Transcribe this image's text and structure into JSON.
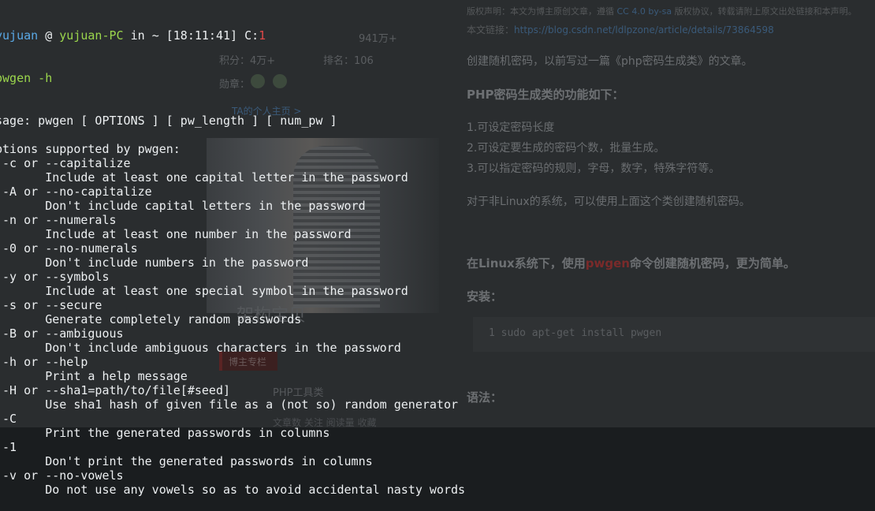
{
  "terminal": {
    "prompt": {
      "user": "yujuan",
      "at": " @ ",
      "host": "yujuan-PC",
      "in": " in ",
      "dir": "~",
      "time": " [18:11:41]",
      "status_label": " C:",
      "status_code": "1"
    },
    "command": "pwgen -h",
    "lines": [
      "sage: pwgen [ OPTIONS ] [ pw_length ] [ num_pw ]",
      "",
      "ptions supported by pwgen:",
      " -c or --capitalize",
      "       Include at least one capital letter in the password",
      " -A or --no-capitalize",
      "       Don't include capital letters in the password",
      " -n or --numerals",
      "       Include at least one number in the password",
      " -0 or --no-numerals",
      "       Don't include numbers in the password",
      " -y or --symbols",
      "       Include at least one special symbol in the password",
      " -s or --secure",
      "       Generate completely random passwords",
      " -B or --ambiguous",
      "       Don't include ambiguous characters in the password",
      " -h or --help",
      "       Print a help message",
      " -H or --sha1=path/to/file[#seed]",
      "       Use sha1 hash of given file as a (not so) random generator",
      " -C",
      "       Print the generated passwords in columns",
      " -1",
      "       Don't print the generated passwords in columns",
      " -v or --no-vowels",
      "       Do not use any vowels so as to avoid accidental nasty words"
    ]
  },
  "background_page": {
    "notice_prefix": "版权声明：本文为博主原创文章，遵循 ",
    "notice_license": "CC 4.0 by-sa",
    "notice_suffix": " 版权协议，转载请附上原文出处链接和本声明。",
    "link_label": "本文链接：",
    "link_url": "https://blog.csdn.net/ldlpzone/article/details/73864598",
    "stat_views_value": "941万+",
    "stat_points_label": "积分：",
    "stat_points_value": "4万+",
    "stat_rank_label": "排名：",
    "stat_rank_value": "106",
    "follow_label": "勋章：",
    "profile_link": "TA的个人主页 >",
    "intro": "创建随机密码，以前写过一篇《php密码生成类》的文章。",
    "php_heading": "PHP密码生成类的功能如下：",
    "features": [
      "1.可设定密码长度",
      "2.可设定要生成的密码个数，批量生成。",
      "3.可以指定密码的规则，字母，数字，特殊字符等。"
    ],
    "non_linux_note": "对于非Linux的系统，可以使用上面这个类创建随机密码。",
    "linux_heading_pre": "在Linux系统下，使用",
    "linux_heading_cmd": "pwgen",
    "linux_heading_post": "命令创建随机密码，更为简单。",
    "install_heading": "安装：",
    "install_code": "1  sudo apt-get install pwgen",
    "syntax_heading": "语法：",
    "photo_caption": "架构宝贝",
    "column_badge": "博主专栏",
    "tool_label": "PHP工具类",
    "footer_text": "文章数  关注  阅读量  收藏"
  },
  "colors": {
    "terminal_fg": "#eceff1",
    "prompt_user": "#5aa9e6",
    "prompt_host": "#9bd64c",
    "status_code": "#e04848"
  }
}
